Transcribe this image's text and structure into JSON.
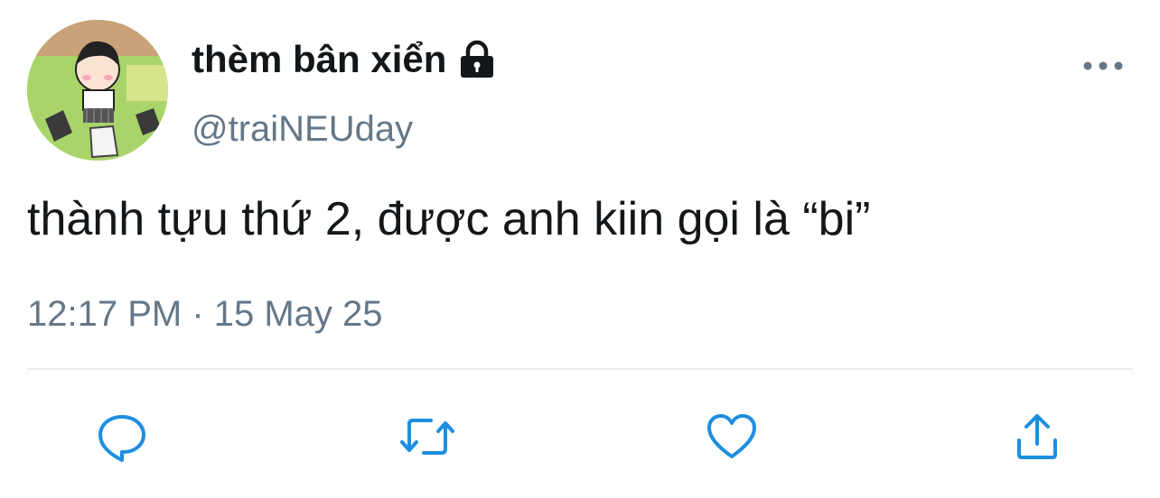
{
  "tweet": {
    "display_name": "thèm bân xiển",
    "handle": "@traiNEUday",
    "protected": true,
    "text": "thành tựu thứ 2, được anh kiin gọi là “bi”",
    "timestamp": "12:17 PM · 15 May 25"
  },
  "icons": {
    "lock": "lock-icon",
    "more": "more-dots-icon",
    "reply": "reply-icon",
    "retweet": "retweet-icon",
    "like": "heart-icon",
    "share": "share-icon"
  },
  "colors": {
    "text": "#14171a",
    "secondary": "#657786",
    "icon": "#1d8fe0",
    "divider": "#e6ecf0"
  }
}
